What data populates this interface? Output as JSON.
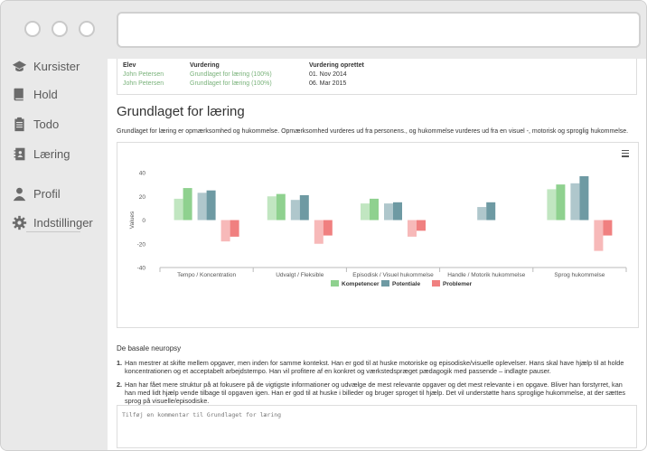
{
  "sidebar": {
    "items": [
      {
        "label": "Kursister",
        "icon": "graduation-cap-icon"
      },
      {
        "label": "Hold",
        "icon": "book-icon"
      },
      {
        "label": "Todo",
        "icon": "clipboard-icon"
      },
      {
        "label": "Læring",
        "icon": "address-book-icon"
      },
      {
        "label": "Profil",
        "icon": "user-icon"
      },
      {
        "label": "Indstillinger",
        "icon": "gear-icon"
      }
    ]
  },
  "person_table": {
    "headers": [
      "Elev",
      "Vurdering",
      "Vurdering oprettet"
    ],
    "rows": [
      [
        "John Petersen",
        "Grundlaget for læring (100%)",
        "01. Nov 2014"
      ],
      [
        "John Petersen",
        "Grundlaget for læring (100%)",
        "06. Mar 2015"
      ]
    ]
  },
  "section": {
    "title": "Grundlaget for læring",
    "description": "Grundlaget for læring er opmærksomhed og hukommelse. Opmærksomhed vurderes ud fra personens., og hukommelse vurderes ud fra en visuel -, motorisk og sproglig hukommelse."
  },
  "chart_data": {
    "type": "bar",
    "categories": [
      "Tempo / Koncentration",
      "Udvalgt / Fleksible",
      "Episodisk / Visuel hukommelse",
      "Handle / Motorik hukommelse",
      "Sprog hukommelse"
    ],
    "ylabel": "Values",
    "ylim": [
      -40,
      40
    ],
    "yticks": [
      40,
      20,
      0,
      -20,
      -40
    ],
    "grid": false,
    "legend_position": "bottom",
    "series": [
      {
        "name": "Kompetencer",
        "color": "#8fd18f",
        "pairs": [
          [
            18,
            27
          ],
          [
            20,
            22
          ],
          [
            14,
            18
          ],
          [
            null,
            null
          ],
          [
            26,
            30
          ]
        ]
      },
      {
        "name": "Potentiale",
        "color": "#6e9aa3",
        "pairs": [
          [
            23,
            25
          ],
          [
            17,
            21
          ],
          [
            14,
            15
          ],
          [
            11,
            15
          ],
          [
            31,
            37
          ]
        ]
      },
      {
        "name": "Problemer",
        "color": "#f08080",
        "pairs": [
          [
            -18,
            -14
          ],
          [
            -20,
            -13
          ],
          [
            -14,
            -9
          ],
          [
            null,
            null
          ],
          [
            -26,
            -13
          ]
        ]
      }
    ]
  },
  "notes": {
    "heading": "De basale neuropsy",
    "items": [
      {
        "n": "1.",
        "text": "Han mestrer at skifte mellem opgaver, men inden for samme kontekst. Han er god til at huske motoriske og episodiske/visuelle oplevelser. Hans skal have hjælp til at holde koncentrationen og et acceptabelt arbejdstempo. Han vil profitere af en konkret og værkstedspræget pædagogik med passende – indlagte pauser."
      },
      {
        "n": "2.",
        "text": "Han har fået mere struktur på at fokusere på de vigtigste informationer og udvælge de mest relevante opgaver og det mest relevante i en opgave. Bliver han forstyrret, kan han med lidt hjælp vende tilbage til opgaven igen. Han er god til at huske i billeder og bruger sproget til hjælp. Det vil understøtte hans sproglige hukommelse, at der sættes sprog på visuelle/episodiske."
      }
    ]
  },
  "comment": {
    "placeholder": "Tilføj en kommentar til Grundlaget for læring"
  }
}
